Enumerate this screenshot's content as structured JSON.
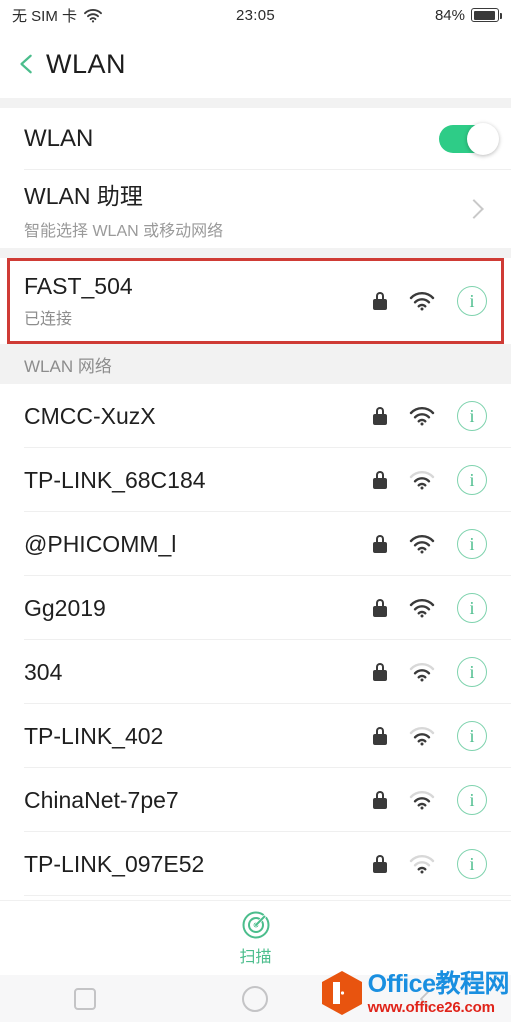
{
  "status_bar": {
    "carrier": "无 SIM 卡",
    "wifi_icon": "wifi-icon",
    "time": "23:05",
    "battery_percent": "84%",
    "battery_level": 84
  },
  "title_bar": {
    "back_icon": "chevron-left-icon",
    "title": "WLAN"
  },
  "settings": {
    "wlan_toggle": {
      "label": "WLAN",
      "enabled": true
    },
    "wlan_assistant": {
      "title": "WLAN 助理",
      "subtitle": "智能选择 WLAN 或移动网络",
      "chevron_icon": "chevron-right-icon"
    }
  },
  "connected_network": {
    "ssid": "FAST_504",
    "status": "已连接",
    "secured": true,
    "signal": 3,
    "lock_icon": "lock-icon",
    "wifi_icon": "wifi-icon",
    "info_icon": "info-icon",
    "highlighted": true
  },
  "section_header": "WLAN 网络",
  "networks": [
    {
      "ssid": "CMCC-XuzX",
      "secured": true,
      "signal": 3
    },
    {
      "ssid": "TP-LINK_68C184",
      "secured": true,
      "signal": 2
    },
    {
      "ssid": "@PHICOMM_l",
      "secured": true,
      "signal": 3
    },
    {
      "ssid": "Gg2019",
      "secured": true,
      "signal": 3
    },
    {
      "ssid": "304",
      "secured": true,
      "signal": 2
    },
    {
      "ssid": "TP-LINK_402",
      "secured": true,
      "signal": 2
    },
    {
      "ssid": "ChinaNet-7pe7",
      "secured": true,
      "signal": 2
    },
    {
      "ssid": "TP-LINK_097E52",
      "secured": true,
      "signal": 1
    }
  ],
  "scan_button": {
    "label": "扫描",
    "icon": "radar-scan-icon"
  },
  "nav_bar": {
    "recents_icon": "square-recents-icon",
    "home_icon": "circle-home-icon",
    "back_icon": "back-arrow-icon"
  },
  "watermark": {
    "logo_icon": "office-logo-icon",
    "title": "Office教程网",
    "url": "www.office26.com"
  },
  "colors": {
    "accent_green": "#2ecc87",
    "info_green": "#4bbd8c",
    "highlight_red": "#cf3b35",
    "section_bg": "#f2f2f2"
  }
}
